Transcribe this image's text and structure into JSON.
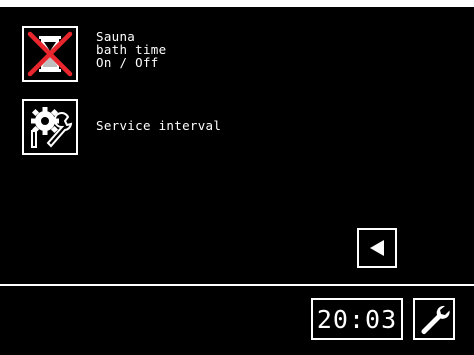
{
  "menu": {
    "items": [
      {
        "icon": "hourglass-crossed-icon",
        "lines": [
          "Sauna",
          "bath time",
          "On / Off"
        ]
      },
      {
        "icon": "gear-wrench-icon",
        "lines": [
          "Service interval"
        ]
      }
    ]
  },
  "navigation": {
    "back_icon": "triangle-left-icon"
  },
  "status_bar": {
    "time": "20:03",
    "settings_icon": "wrench-icon"
  },
  "colors": {
    "background": "#000000",
    "foreground": "#ffffff",
    "cross": "#e8262d"
  }
}
